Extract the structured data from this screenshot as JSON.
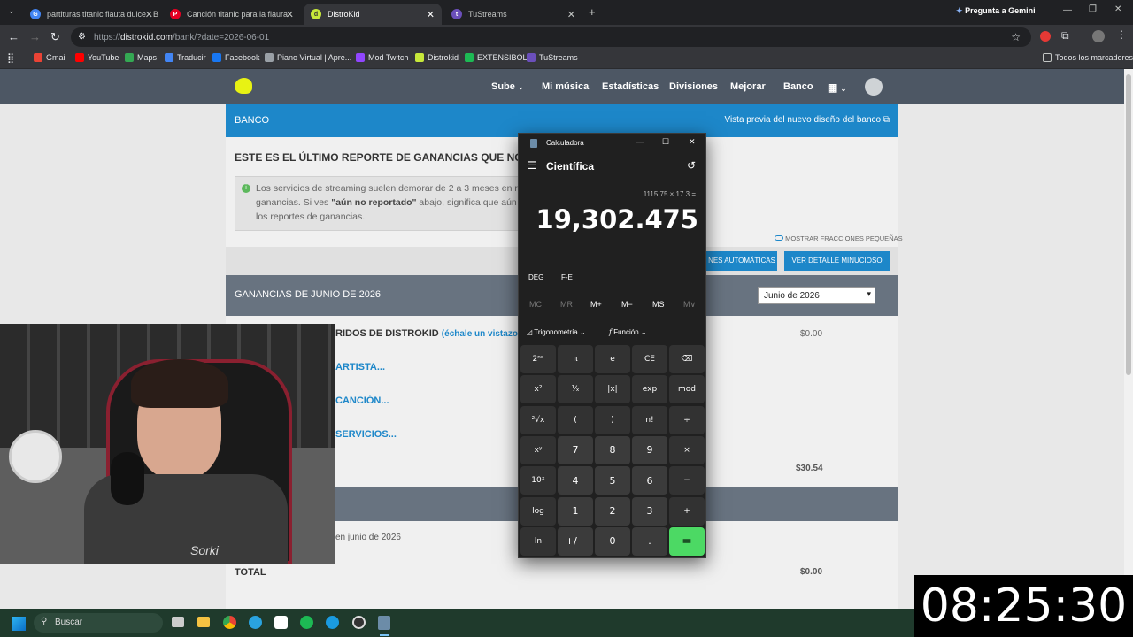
{
  "browser": {
    "tabs": [
      {
        "label": "partituras titanic flauta dulce - B",
        "icon": "google-icon",
        "color": "#4285f4"
      },
      {
        "label": "Canción titanic para la flaura",
        "icon": "pinterest-icon",
        "color": "#e60023"
      },
      {
        "label": "DistroKid",
        "icon": "distrokid-icon",
        "color": "#c7e83a"
      },
      {
        "label": "TuStreams",
        "icon": "tustreams-icon",
        "color": "#6b4fbb"
      }
    ],
    "gemini_label": "Pregunta a Gemini",
    "url_scheme": "https://",
    "url_host": "distrokid.com",
    "url_path": "/bank/?date=2026-06-01",
    "bookmarks": [
      "Gmail",
      "YouTube",
      "Maps",
      "Traducir",
      "Facebook",
      "Piano Virtual | Apre...",
      "Mod Twitch",
      "Distrokid",
      "EXTENSIBOL",
      "TuStreams"
    ],
    "all_bookmarks": "Todos los marcadores"
  },
  "site": {
    "nav": [
      "Sube",
      "Mi música",
      "Estadísticas",
      "Divisiones",
      "Mejorar",
      "Banco"
    ],
    "bank_title": "BANCO",
    "bank_preview": "Vista previa del nuevo diseño del banco",
    "report_heading": "ESTE ES EL ÚLTIMO REPORTE DE GANANCIAS QUE NOS ENV",
    "info_line1": "Los servicios de streaming suelen demorar de 2 a 3 meses en rep",
    "info_line2a": "ganancias. Si ves ",
    "info_bold": "\"aún no reportado\"",
    "info_line2b": " abajo, significa que aún no",
    "info_line3": "los reportes de ganancias.",
    "small_fractions": "MOSTRAR FRACCIONES PEQUEÑAS",
    "btn_auto": "NES AUTOMÁTICAS",
    "btn_detail": "VER DETALLE MINUCIOSO",
    "earnings_title": "GANANCIAS DE JUNIO DE 2026",
    "month_select": "Junio de 2026",
    "row_distrokid": "RIDOS DE DISTROKID",
    "row_distrokid_link": "(échale un vistazo)",
    "row_distrokid_value": "$0.00",
    "link_artist": "ARTISTA...",
    "link_song": "CANCIÓN...",
    "link_services": "SERVICIOS...",
    "subtotal": "$30.54",
    "june_text": "en junio de 2026",
    "total_label": "TOTAL",
    "total_value": "$0.00"
  },
  "calculator": {
    "window_title": "Calculadora",
    "mode": "Científica",
    "expression": "1115.75 × 17.3 =",
    "result": "19,302.475",
    "deg": "DEG",
    "fe": "F-E",
    "memory": [
      "MC",
      "MR",
      "M+",
      "M−",
      "MS",
      "M∨"
    ],
    "trig": "Trigonometría",
    "func": "Función",
    "keys": [
      [
        "2ⁿᵈ",
        "π",
        "e",
        "CE",
        "⌫"
      ],
      [
        "x²",
        "¹⁄ₓ",
        "|x|",
        "exp",
        "mod"
      ],
      [
        "²√x",
        "(",
        ")",
        "n!",
        "÷"
      ],
      [
        "xʸ",
        "7",
        "8",
        "9",
        "×"
      ],
      [
        "10ˣ",
        "4",
        "5",
        "6",
        "−"
      ],
      [
        "log",
        "1",
        "2",
        "3",
        "+"
      ],
      [
        "ln",
        "+/−",
        "0",
        ".",
        "="
      ]
    ]
  },
  "webcam": {
    "shirt_text": "Sorki"
  },
  "taskbar": {
    "search": "Buscar"
  },
  "clock": "08:25:30"
}
